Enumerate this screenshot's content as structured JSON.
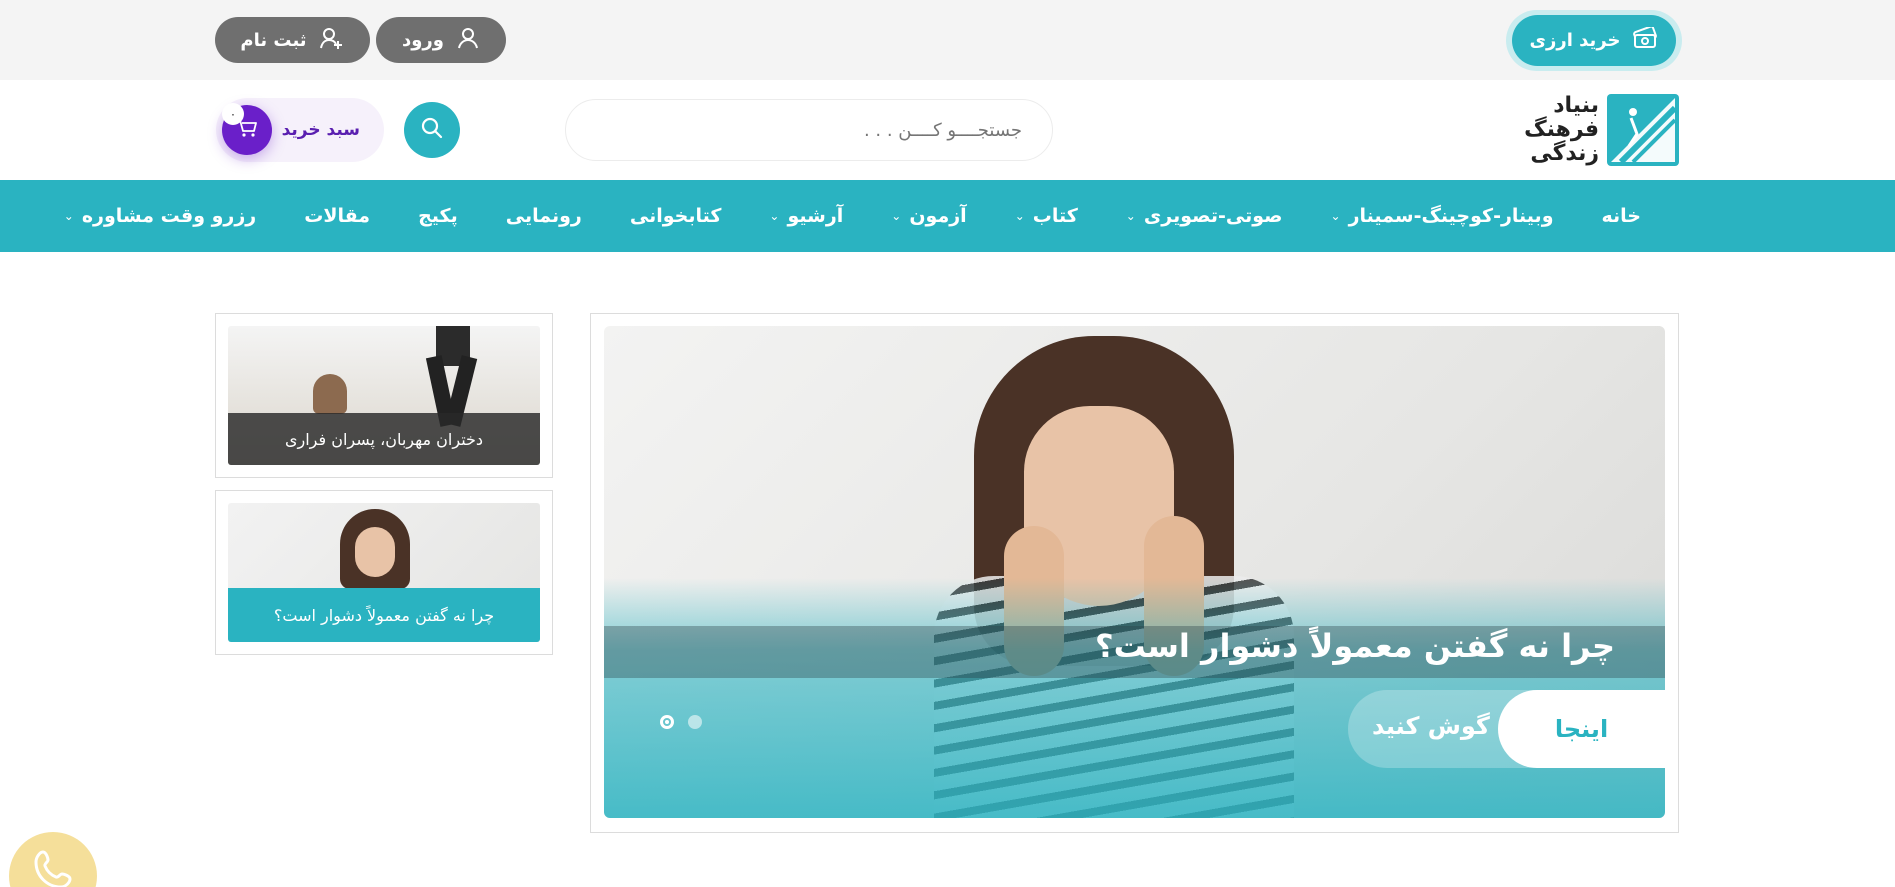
{
  "topbar": {
    "forex_label": "خرید ارزی",
    "login_label": "ورود",
    "register_label": "ثبت نام"
  },
  "header": {
    "logo_lines": [
      "بنیاد",
      "فرهنگ",
      "زندگی"
    ],
    "search_placeholder": "جستجــــو کــــن . . .",
    "cart_label": "سبد خرید",
    "cart_count": "۰"
  },
  "nav": {
    "items": [
      {
        "label": "خانه",
        "has_dropdown": false
      },
      {
        "label": "وبینار-کوچینگ-سمینار",
        "has_dropdown": true
      },
      {
        "label": "صوتی-تصویری",
        "has_dropdown": true
      },
      {
        "label": "کتاب",
        "has_dropdown": true
      },
      {
        "label": "آزمون",
        "has_dropdown": true
      },
      {
        "label": "آرشیو",
        "has_dropdown": true
      },
      {
        "label": "کتابخوانی",
        "has_dropdown": false
      },
      {
        "label": "رونمایی",
        "has_dropdown": false
      },
      {
        "label": "پکیج",
        "has_dropdown": false
      },
      {
        "label": "مقالات",
        "has_dropdown": false
      },
      {
        "label": "رزرو وقت مشاوره",
        "has_dropdown": true
      }
    ]
  },
  "slider": {
    "title": "چرا نه گفتن معمولاً دشوار است؟",
    "listen_label": "گوش کنید",
    "here_label": "اینجا",
    "dots": 2,
    "active_dot": 0
  },
  "side_cards": [
    {
      "caption": "دختران مهربان، پسران فراری"
    },
    {
      "caption": "چرا نه گفتن معمولاً دشوار است؟"
    }
  ],
  "colors": {
    "accent": "#2ab3c1",
    "topbar_bg": "#f4f4f4",
    "pill_gray": "#6f6f6f",
    "cart_purple": "#6a1fc9",
    "phone_yellow": "#f5df9a"
  }
}
